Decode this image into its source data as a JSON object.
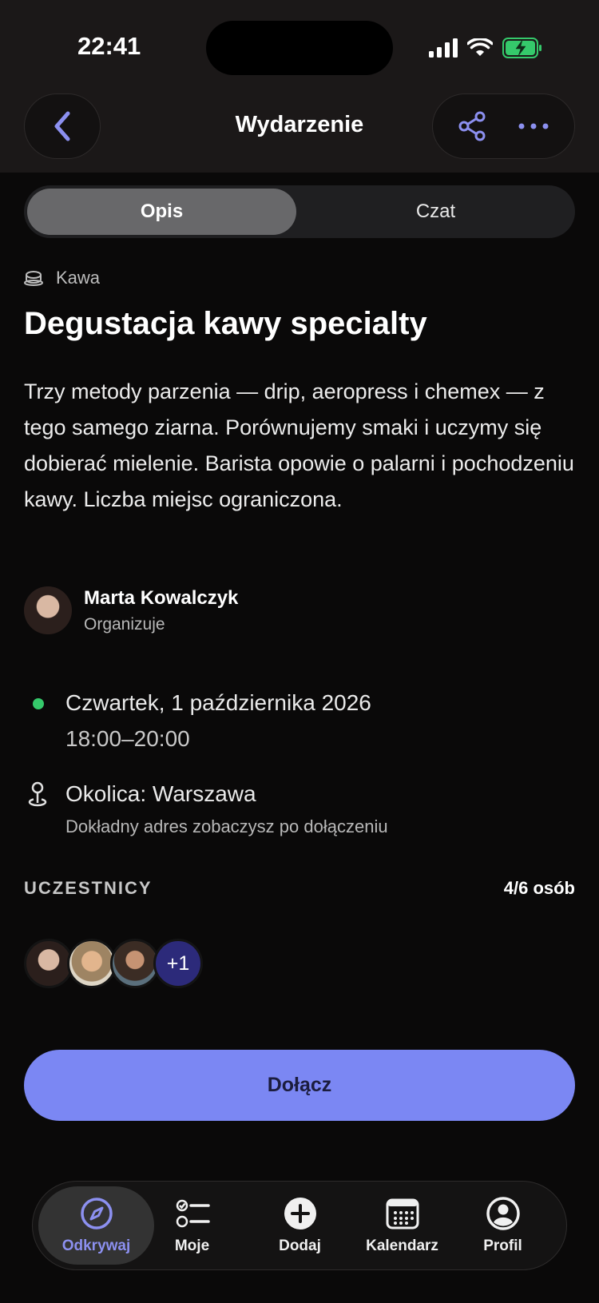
{
  "status_bar": {
    "time": "22:41"
  },
  "header": {
    "title": "Wydarzenie"
  },
  "tabs": {
    "active": "Opis",
    "inactive": "Czat"
  },
  "event": {
    "category": "Kawa",
    "title": "Degustacja kawy specialty",
    "description": "Trzy metody parzenia — drip, aeropress i chemex — z tego samego ziarna. Porównujemy smaki i uczymy się dobierać mielenie. Barista opowie o palarni i pochodzeniu kawy. Liczba miejsc ograniczona.",
    "organizer": {
      "name": "Marta Kowalczyk",
      "role": "Organizuje"
    },
    "date": "Czwartek, 1 października 2026",
    "time": "18:00–20:00",
    "location": "Okolica: Warszawa",
    "location_note": "Dokładny adres zobaczysz po dołączeniu"
  },
  "participants": {
    "label": "UCZESTNICY",
    "count": "4/6 osób",
    "more": "+1"
  },
  "join_label": "Dołącz",
  "bottom_nav": {
    "items": [
      {
        "label": "Odkrywaj",
        "icon": "compass-icon"
      },
      {
        "label": "Moje",
        "icon": "checklist-icon"
      },
      {
        "label": "Dodaj",
        "icon": "plus-circle-icon"
      },
      {
        "label": "Kalendarz",
        "icon": "calendar-icon"
      },
      {
        "label": "Profil",
        "icon": "profile-icon"
      }
    ]
  },
  "colors": {
    "accent": "#7b87f3",
    "live_dot": "#35c96b",
    "background": "#0a0909"
  }
}
